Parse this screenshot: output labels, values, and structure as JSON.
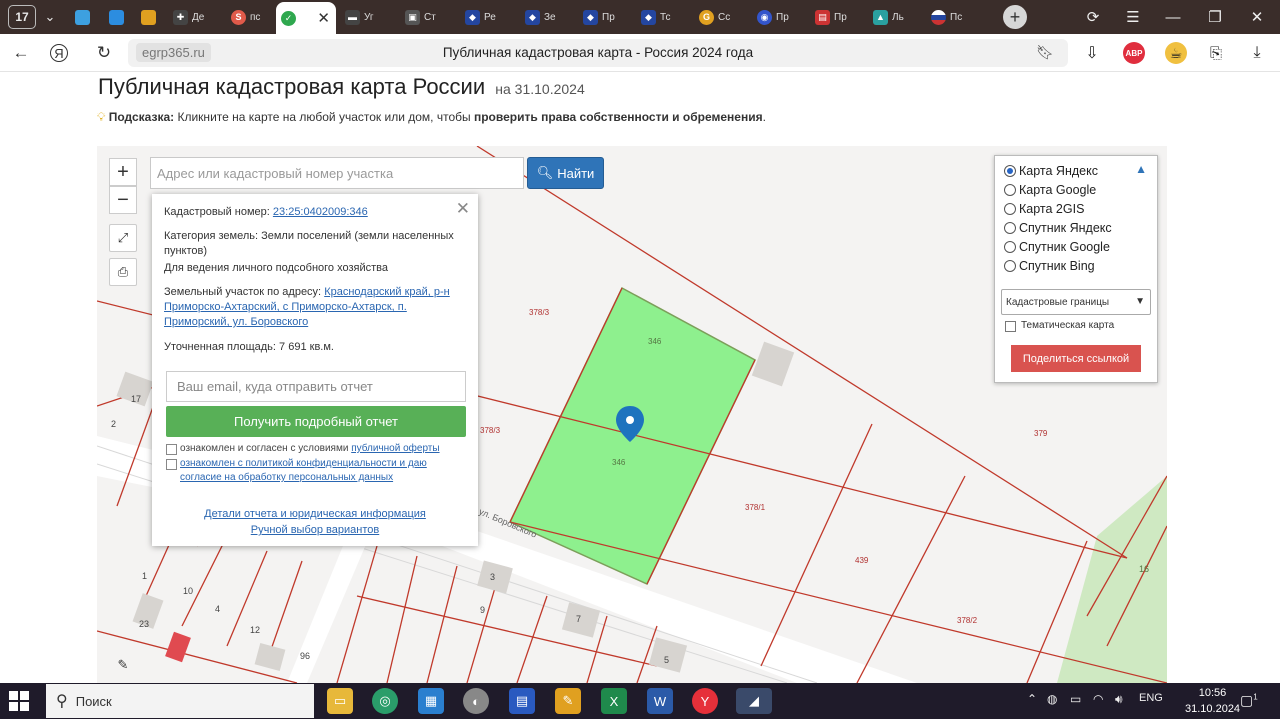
{
  "browser": {
    "tab_counter": "17",
    "tabs": [
      {
        "label": "",
        "color": "#3da0e0"
      },
      {
        "label": "",
        "color": "#2c8de0"
      },
      {
        "label": "",
        "color": "#e0a020"
      },
      {
        "label": "Де",
        "color": "#444444"
      },
      {
        "label": "пс",
        "color": "#e05a4a"
      },
      {
        "label": "",
        "color": "#2fa84f",
        "active": true
      },
      {
        "label": "Уг",
        "color": "#444444"
      },
      {
        "label": "Ст",
        "color": "#555555"
      },
      {
        "label": "Ре",
        "color": "#2446a0"
      },
      {
        "label": "Зе",
        "color": "#2446a0"
      },
      {
        "label": "Пр",
        "color": "#2446a0"
      },
      {
        "label": "Тс",
        "color": "#2446a0"
      },
      {
        "label": "Сс",
        "color": "#e0a020"
      },
      {
        "label": "Пр",
        "color": "#3355cc"
      },
      {
        "label": "Пр",
        "color": "#cc3333"
      },
      {
        "label": "Ль",
        "color": "#2aa0a0"
      },
      {
        "label": "Пс",
        "color": "#cc3333"
      }
    ],
    "url_domain": "egrp365.ru",
    "page_title": "Публичная кадастровая карта - Россия 2024 года"
  },
  "page": {
    "heading": "Публичная кадастровая карта России",
    "heading_date": "на 31.10.2024",
    "hint_label": "Подсказка:",
    "hint_text": " Кликните на карте на любой участок или дом, чтобы ",
    "hint_bold": "проверить права собственности и обременения",
    "hint_end": "."
  },
  "map": {
    "zoom_in": "+",
    "zoom_out": "−",
    "search_placeholder": "Адрес или кадастровый номер участка",
    "search_button": "Найти",
    "popup": {
      "cadastral_label": "Кадастровый номер:",
      "cadastral_number": "23:25:0402009:346",
      "category_label": "Категория земель:",
      "category_value": "Земли поселений (земли населенных пунктов)",
      "use": "Для ведения личного подсобного хозяйства",
      "address_label": "Земельный участок по адресу:",
      "address_value": "Краснодарский край, р-н Приморско-Ахтарский, с Приморско-Ахтарск, п. Приморский, ул. Боровского",
      "area_label": "Уточненная площадь:",
      "area_value": "7 691 кв.м.",
      "email_placeholder": "Ваш email, куда отправить отчет",
      "report_button": "Получить подробный отчет",
      "consent1_text": "ознакомлен и согласен с условиями ",
      "consent1_link": "публичной оферты",
      "consent2_text": "ознакомлен с политикой конфиденциальности и даю согласие на обработку персональных данных",
      "details_link": "Детали отчета и юридическая информация",
      "manual_link": "Ручной выбор вариантов"
    },
    "layers": {
      "options": [
        {
          "label": "Карта Яндекс",
          "selected": true
        },
        {
          "label": "Карта Google",
          "selected": false
        },
        {
          "label": "Карта 2GIS",
          "selected": false
        },
        {
          "label": "Спутник Яндекс",
          "selected": false
        },
        {
          "label": "Спутник Google",
          "selected": false
        },
        {
          "label": "Спутник Bing",
          "selected": false
        }
      ],
      "overlay_select": "Кадастровые границы",
      "thematic_label": "Тематическая карта",
      "share_button": "Поделиться ссылкой"
    },
    "parcel_labels": {
      "p378_3a": "378/3",
      "p346_top": "346",
      "p346_mid": "346",
      "p378_3b": "378/3",
      "p379": "379",
      "p378_1": "378/1",
      "p439": "439",
      "p378_2": "378/2"
    },
    "house_numbers": {
      "h17": "17",
      "h2": "2",
      "h1": "1",
      "h10": "10",
      "h4": "4",
      "h12": "12",
      "h23": "23",
      "h96": "96",
      "h9": "9",
      "h3": "3",
      "h7": "7",
      "h5": "5",
      "h16": "16"
    },
    "street_label": "ул. Боровского",
    "colors": {
      "highlight_parcel": "#8ef08e",
      "parcel_border": "#c0392b",
      "marker": "#1e73be"
    }
  },
  "taskbar": {
    "search_label": "Поиск",
    "lang": "ENG",
    "time": "10:56",
    "date": "31.10.2024",
    "notification_count": "1"
  }
}
